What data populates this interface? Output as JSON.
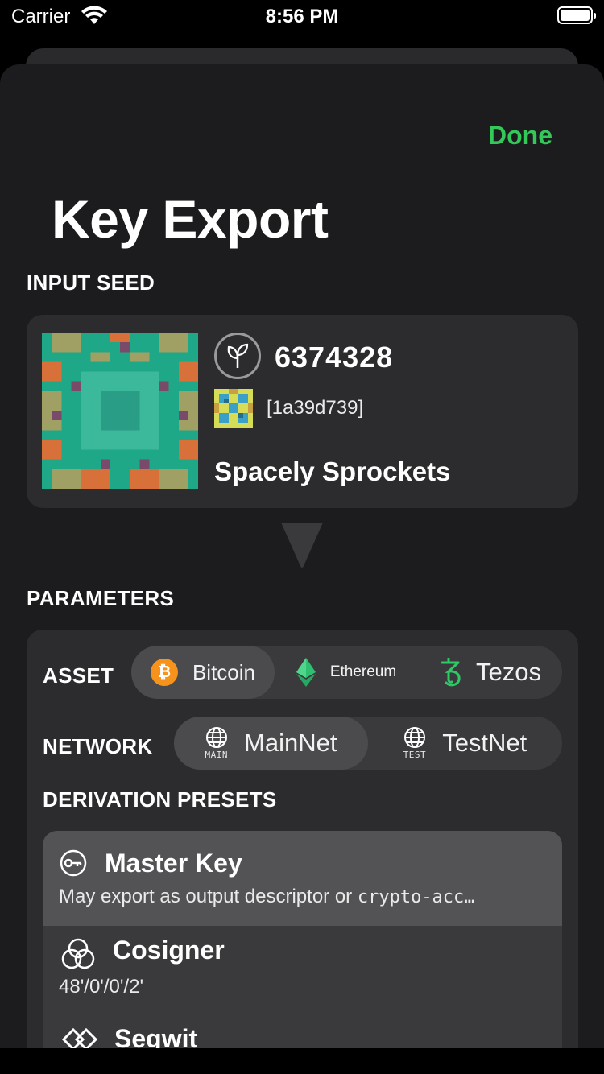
{
  "status": {
    "carrier": "Carrier",
    "time": "8:56 PM"
  },
  "header": {
    "done_label": "Done",
    "title": "Key Export"
  },
  "input_seed": {
    "section_label": "INPUT SEED",
    "number": "6374328",
    "fingerprint": "[1a39d739]",
    "name": "Spacely Sprockets",
    "icon": "seedling-icon"
  },
  "parameters": {
    "section_label": "PARAMETERS",
    "asset": {
      "label": "ASSET",
      "options": [
        {
          "label": "Bitcoin",
          "icon": "bitcoin-icon",
          "selected": true
        },
        {
          "label": "Ethereum",
          "icon": "ethereum-icon",
          "selected": false
        },
        {
          "label": "Tezos",
          "icon": "tezos-icon",
          "selected": false
        }
      ]
    },
    "network": {
      "label": "NETWORK",
      "options": [
        {
          "label": "MainNet",
          "icon_caption": "MAIN",
          "icon": "globe-icon",
          "selected": true
        },
        {
          "label": "TestNet",
          "icon_caption": "TEST",
          "icon": "globe-icon",
          "selected": false
        }
      ]
    },
    "derivation": {
      "label": "DERIVATION PRESETS",
      "presets": [
        {
          "title": "Master Key",
          "subtitle_prefix": "May export as output descriptor or ",
          "subtitle_code": "crypto-acc…",
          "icon": "key-icon",
          "selected": true
        },
        {
          "title": "Cosigner",
          "subtitle": "48'/0'/0'/2'",
          "icon": "cosigner-icon",
          "selected": false
        },
        {
          "title": "Segwit",
          "icon": "segwit-icon",
          "selected": false
        }
      ]
    }
  },
  "colors": {
    "accent": "#34c759",
    "background": "#1c1c1e",
    "card": "#2c2c2e",
    "bitcoin": "#f7931a",
    "ethereum": "#3cb371",
    "tezos": "#2ec866"
  }
}
